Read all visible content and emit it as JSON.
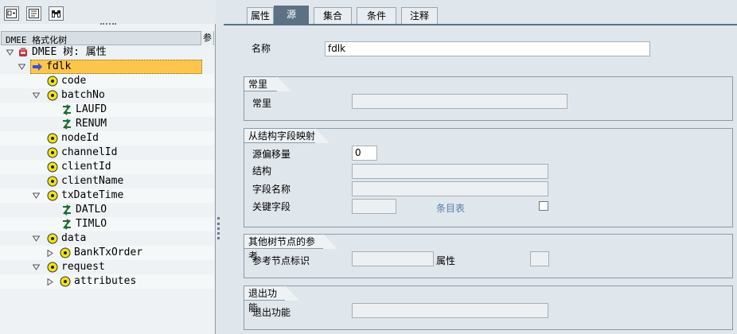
{
  "toolbar": {
    "buttons": [
      {
        "icon": "expand-node-icon"
      },
      {
        "icon": "collapse-node-icon"
      },
      {
        "icon": "binoculars-icon"
      }
    ]
  },
  "tree": {
    "header_title": "DMEE 格式化树",
    "header_button": "参",
    "root_label": "DMEE 树: 属性",
    "nodes": {
      "fdlk": "fdlk",
      "code": "code",
      "batchNo": "batchNo",
      "LAUFD": "LAUFD",
      "RENUM": "RENUM",
      "nodeId": "nodeId",
      "channelId": "channelId",
      "clientId": "clientId",
      "clientName": "clientName",
      "txDateTime": "txDateTime",
      "DATLO": "DATLO",
      "TIMLO": "TIMLO",
      "data": "data",
      "BankTxOrder": "BankTxOrder",
      "request": "request",
      "attributes": "attributes"
    }
  },
  "tabs": [
    "属性",
    "源",
    "集合",
    "条件",
    "注释"
  ],
  "active_tab": "源",
  "form": {
    "name_label": "名称",
    "name_value": "fdlk",
    "constant_group": {
      "title": "常里",
      "label": "常里",
      "value": ""
    },
    "mapping_group": {
      "title": "从结构字段映射",
      "offset_label": "源偏移量",
      "offset_value": "0",
      "structure_label": "结构",
      "structure_value": "",
      "field_label": "字段名称",
      "field_value": "",
      "key_label": "关键字段",
      "key_value": "",
      "link_label": "条目表"
    },
    "ref_group": {
      "title": "其他树节点的参考",
      "ref_label": "参考节点标识",
      "ref_value": "",
      "attr_label": "属性",
      "attr_value": ""
    },
    "exit_group": {
      "title": "退出功能",
      "exit_label": "退出功能",
      "exit_value": ""
    }
  },
  "colors": {
    "selected_row": "#fcc64c",
    "active_tab": "#5e7184",
    "link": "#5a7fa6",
    "node_yellow": "#f0e414"
  }
}
